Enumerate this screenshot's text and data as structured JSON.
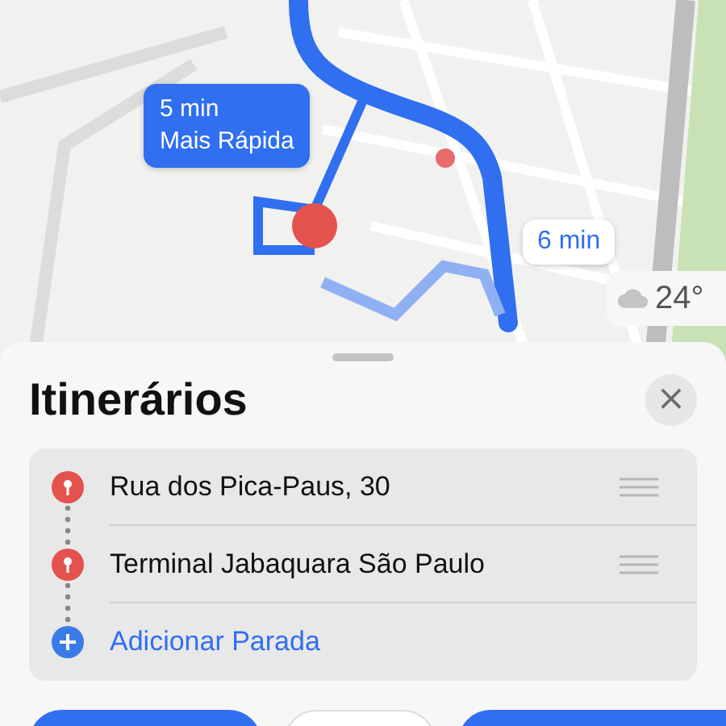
{
  "route_callouts": [
    {
      "time": "5 min",
      "label": "Mais Rápida",
      "selected": true
    },
    {
      "time": "6 min",
      "selected": false
    }
  ],
  "weather": {
    "temperature": "24°"
  },
  "sheet": {
    "title": "Itinerários",
    "close": "×"
  },
  "stops": [
    {
      "kind": "stop",
      "name": "Rua dos Pica-Paus, 30"
    },
    {
      "kind": "stop",
      "name": "Terminal Jabaquara São Paulo"
    },
    {
      "kind": "add",
      "name": "Adicionar Parada"
    }
  ],
  "bottom_buttons": [
    {
      "kind": "primary"
    },
    {
      "kind": "secondary"
    },
    {
      "kind": "primary"
    }
  ]
}
